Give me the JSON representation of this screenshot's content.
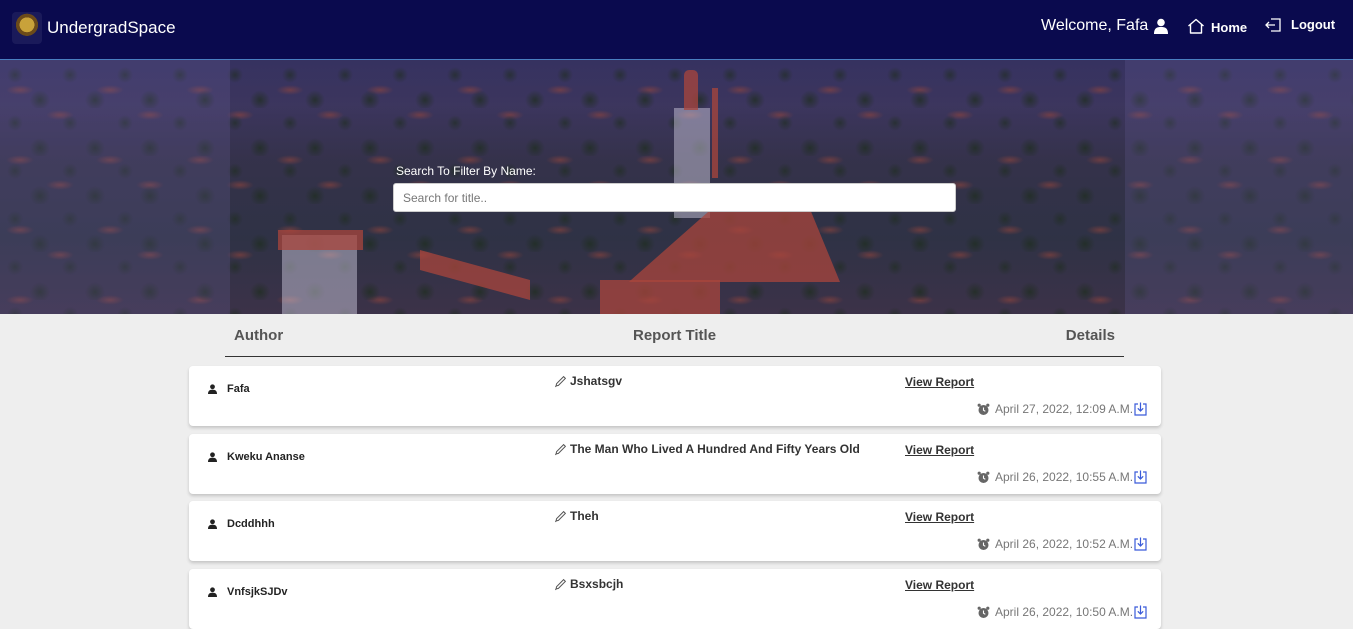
{
  "navbar": {
    "brand": "UndergradSpace",
    "welcome": "Welcome, Fafa",
    "home": "Home",
    "logout": "Logout"
  },
  "search": {
    "label": "Search To Filter By Name:",
    "placeholder": "Search for title.."
  },
  "table": {
    "headers": {
      "author": "Author",
      "title": "Report Title",
      "details": "Details"
    },
    "rows": [
      {
        "author": "Fafa",
        "title": "Jshatsgv",
        "link": "View Report",
        "date": "April 27, 2022, 12:09 A.M."
      },
      {
        "author": "Kweku Ananse",
        "title": "The Man Who Lived A Hundred And Fifty Years Old",
        "link": "View Report",
        "date": "April 26, 2022, 10:55 A.M."
      },
      {
        "author": "Dcddhhh",
        "title": "Theh",
        "link": "View Report",
        "date": "April 26, 2022, 10:52 A.M."
      },
      {
        "author": "VnfsjkSJDv",
        "title": "Bsxsbcjh",
        "link": "View Report",
        "date": "April 26, 2022, 10:50 A.M."
      }
    ]
  },
  "icons": {
    "author": "user-icon",
    "title": "pencil-icon",
    "date": "alarm-clock-icon",
    "download": "download-icon"
  },
  "colors": {
    "navbar": "#0a0a4e",
    "download_icon": "#3a5bd9"
  }
}
